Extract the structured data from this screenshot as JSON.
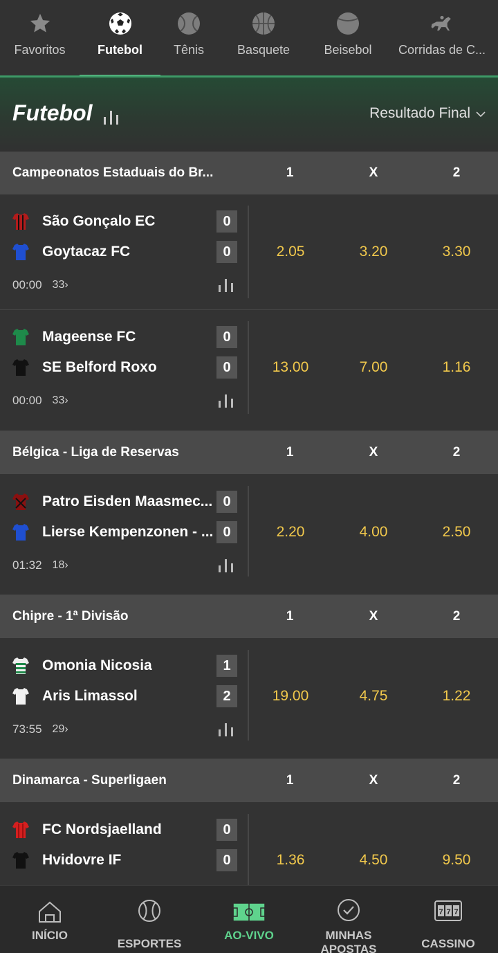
{
  "sports_nav": {
    "tabs": [
      {
        "label": "Favoritos",
        "icon": "star-icon"
      },
      {
        "label": "Futebol",
        "icon": "soccer-ball-icon",
        "active": true
      },
      {
        "label": "Tênis",
        "icon": "tennis-ball-icon"
      },
      {
        "label": "Basquete",
        "icon": "basketball-icon"
      },
      {
        "label": "Beisebol",
        "icon": "baseball-icon"
      },
      {
        "label": "Corridas de C...",
        "icon": "horse-racing-icon"
      }
    ]
  },
  "header": {
    "title": "Futebol",
    "market_select": "Resultado Final"
  },
  "leagues": [
    {
      "name": "Campeonatos Estaduais do Br...",
      "cols": [
        "1",
        "X",
        "2"
      ],
      "matches": [
        {
          "home": "São Gonçalo EC",
          "away": "Goytacaz FC",
          "home_score": "0",
          "away_score": "0",
          "time": "00:00",
          "more": "33",
          "odds": [
            "2.05",
            "3.20",
            "3.30"
          ]
        },
        {
          "home": "Mageense FC",
          "away": "SE Belford Roxo",
          "home_score": "0",
          "away_score": "0",
          "time": "00:00",
          "more": "33",
          "odds": [
            "13.00",
            "7.00",
            "1.16"
          ]
        }
      ]
    },
    {
      "name": "Bélgica - Liga de Reservas",
      "cols": [
        "1",
        "X",
        "2"
      ],
      "matches": [
        {
          "home": "Patro Eisden Maasmec...",
          "away": "Lierse Kempenzonen - ...",
          "home_score": "0",
          "away_score": "0",
          "time": "01:32",
          "more": "18",
          "odds": [
            "2.20",
            "4.00",
            "2.50"
          ]
        }
      ]
    },
    {
      "name": "Chipre - 1ª Divisão",
      "cols": [
        "1",
        "X",
        "2"
      ],
      "matches": [
        {
          "home": "Omonia Nicosia",
          "away": "Aris Limassol",
          "home_score": "1",
          "away_score": "2",
          "time": "73:55",
          "more": "29",
          "odds": [
            "19.00",
            "4.75",
            "1.22"
          ]
        }
      ]
    },
    {
      "name": "Dinamarca - Superligaen",
      "cols": [
        "1",
        "X",
        "2"
      ],
      "matches": [
        {
          "home": "FC Nordsjaelland",
          "away": "Hvidovre IF",
          "home_score": "0",
          "away_score": "0",
          "odds": [
            "1.36",
            "4.50",
            "9.50"
          ]
        }
      ]
    }
  ],
  "bottom_nav": {
    "items": [
      {
        "label": "INÍCIO",
        "icon": "home-icon"
      },
      {
        "label": "ESPORTES",
        "icon": "sports-ball-icon"
      },
      {
        "label": "AO-VIVO",
        "icon": "live-pitch-icon",
        "active": true
      },
      {
        "label": "MINHAS APOSTAS",
        "label_line1": "MINHAS",
        "label_line2": "APOSTAS",
        "icon": "checkmark-circle-icon"
      },
      {
        "label": "CASSINO",
        "icon": "slot-machine-icon"
      }
    ]
  },
  "colors": {
    "accent_green": "#5fd38d",
    "odds_yellow": "#f2c94c",
    "league_bg": "#4a4a4a",
    "row_bg": "#333333"
  }
}
